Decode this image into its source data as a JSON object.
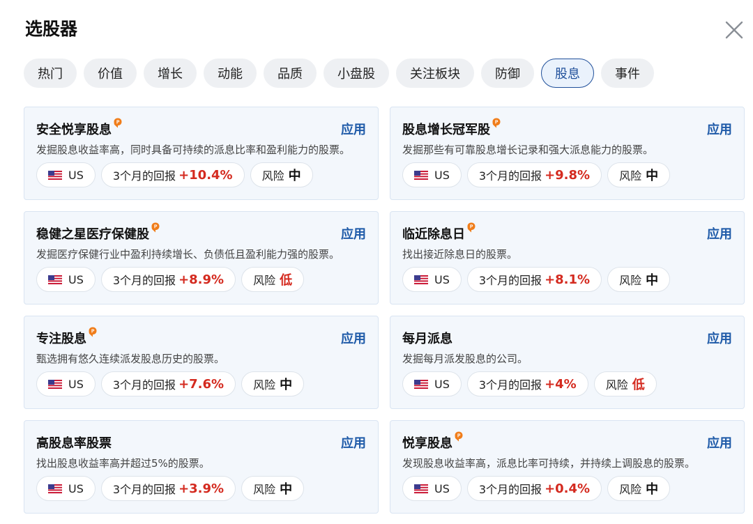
{
  "title": "选股器",
  "tabs": [
    {
      "label": "热门",
      "active": false
    },
    {
      "label": "价值",
      "active": false
    },
    {
      "label": "增长",
      "active": false
    },
    {
      "label": "动能",
      "active": false
    },
    {
      "label": "品质",
      "active": false
    },
    {
      "label": "小盘股",
      "active": false
    },
    {
      "label": "关注板块",
      "active": false
    },
    {
      "label": "防御",
      "active": false
    },
    {
      "label": "股息",
      "active": true
    },
    {
      "label": "事件",
      "active": false
    }
  ],
  "apply_label": "应用",
  "return_label": "3个月的回报",
  "risk_label": "风险",
  "colors": {
    "accent": "#1e5aa8",
    "positive": "#d42a1f",
    "card_bg": "#f3f7fc",
    "pro_badge": "#f07d1a"
  },
  "cards": [
    {
      "title": "安全悦享股息",
      "pro": true,
      "description": "发掘股息收益率高，同时具备可持续的派息比率和盈利能力的股票。",
      "market": "US",
      "return": "+10.4%",
      "risk": "中"
    },
    {
      "title": "股息增长冠军股",
      "pro": true,
      "description": "发掘那些有可靠股息增长记录和强大派息能力的股票。",
      "market": "US",
      "return": "+9.8%",
      "risk": "中"
    },
    {
      "title": "稳健之星医疗保健股",
      "pro": true,
      "description": "发掘医疗保健行业中盈利持续增长、负债低且盈利能力强的股票。",
      "market": "US",
      "return": "+8.9%",
      "risk": "低"
    },
    {
      "title": "临近除息日",
      "pro": true,
      "description": "找出接近除息日的股票。",
      "market": "US",
      "return": "+8.1%",
      "risk": "中"
    },
    {
      "title": "专注股息",
      "pro": true,
      "description": "甄选拥有悠久连续派发股息历史的股票。",
      "market": "US",
      "return": "+7.6%",
      "risk": "中"
    },
    {
      "title": "每月派息",
      "pro": false,
      "description": "发掘每月派发股息的公司。",
      "market": "US",
      "return": "+4%",
      "risk": "低"
    },
    {
      "title": "高股息率股票",
      "pro": false,
      "description": "找出股息收益率高并超过5%的股票。",
      "market": "US",
      "return": "+3.9%",
      "risk": "中"
    },
    {
      "title": "悦享股息",
      "pro": true,
      "description": "发现股息收益率高，派息比率可持续，并持续上调股息的股票。",
      "market": "US",
      "return": "+0.4%",
      "risk": "中"
    }
  ]
}
